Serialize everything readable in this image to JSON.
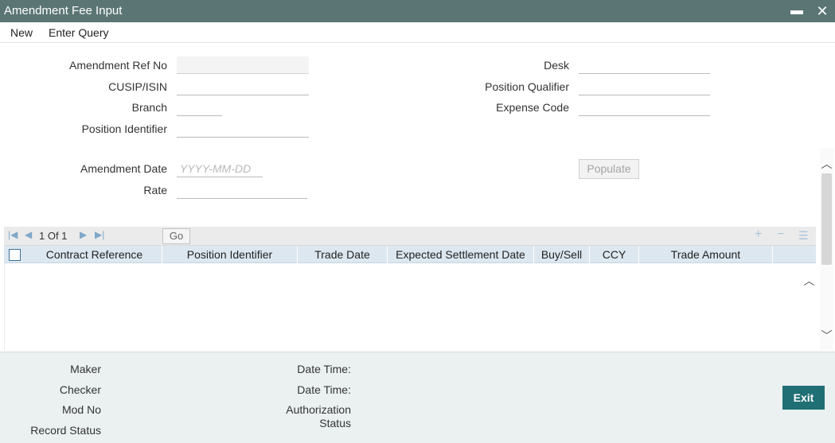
{
  "window": {
    "title": "Amendment Fee Input",
    "minimize_glyph": "▬",
    "close_glyph": "✕"
  },
  "menu": {
    "new_label": "New",
    "enter_query_label": "Enter Query"
  },
  "form": {
    "amendment_ref_no_label": "Amendment Ref No",
    "amendment_ref_no_value": "",
    "cusip_isin_label": "CUSIP/ISIN",
    "cusip_isin_value": "",
    "branch_label": "Branch",
    "branch_value": "",
    "position_identifier_label": "Position Identifier",
    "position_identifier_value": "",
    "desk_label": "Desk",
    "desk_value": "",
    "position_qualifier_label": "Position Qualifier",
    "position_qualifier_value": "",
    "expense_code_label": "Expense Code",
    "expense_code_value": "",
    "amendment_date_label": "Amendment Date",
    "amendment_date_placeholder": "YYYY-MM-DD",
    "rate_label": "Rate",
    "rate_value": "",
    "populate_label": "Populate"
  },
  "grid": {
    "pagination_text": "1 Of 1",
    "go_label": "Go",
    "icons": [
      "first-page-icon",
      "previous-page-icon",
      "next-page-icon",
      "last-page-icon",
      "add-row-icon",
      "delete-row-icon",
      "list-view-icon"
    ],
    "columns": [
      "Contract Reference",
      "Position Identifier",
      "Trade Date",
      "Expected Settlement Date",
      "Buy/Sell",
      "CCY",
      "Trade Amount"
    ],
    "rows": []
  },
  "footer": {
    "maker_label": "Maker",
    "checker_label": "Checker",
    "mod_no_label": "Mod No",
    "record_status_label": "Record Status",
    "date_time_label_1": "Date Time:",
    "date_time_label_2": "Date Time:",
    "authorization_label": "Authorization",
    "status_label": "Status",
    "exit_label": "Exit"
  },
  "colors": {
    "titlebar": "#5a7574",
    "grid_header": "#dde7f0",
    "footer": "#ebf1f1",
    "exit_button": "#1f6f74"
  }
}
